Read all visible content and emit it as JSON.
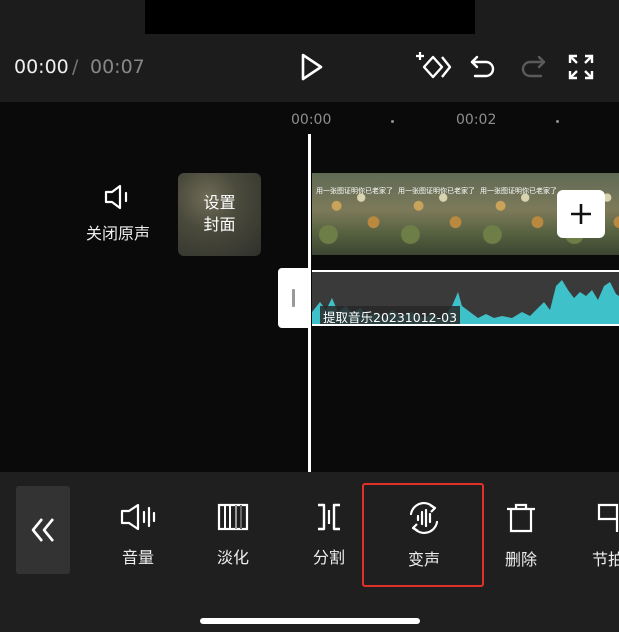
{
  "player": {
    "current_time": "00:00",
    "separator": "/",
    "total_time": "00:07"
  },
  "ruler": {
    "labels": [
      "00:00",
      "00:02"
    ]
  },
  "track_header": {
    "mute_label": "关闭原声"
  },
  "cover": {
    "line1": "设置",
    "line2": "封面"
  },
  "video_track": {
    "frame_caption": "用一张图证明你已老家了"
  },
  "audio_track": {
    "label": "提取音乐20231012-03",
    "color": "#3fc1c9"
  },
  "toolbar": {
    "items": [
      {
        "label": "音量",
        "icon": "speaker-volume-icon"
      },
      {
        "label": "淡化",
        "icon": "fade-icon"
      },
      {
        "label": "分割",
        "icon": "split-icon"
      },
      {
        "label": "变声",
        "icon": "voice-changer-icon"
      },
      {
        "label": "删除",
        "icon": "trash-icon"
      },
      {
        "label": "节拍",
        "icon": "beat-flag-icon"
      }
    ]
  },
  "colors": {
    "highlight": "#e0302a",
    "background": "#1c1c1c"
  }
}
